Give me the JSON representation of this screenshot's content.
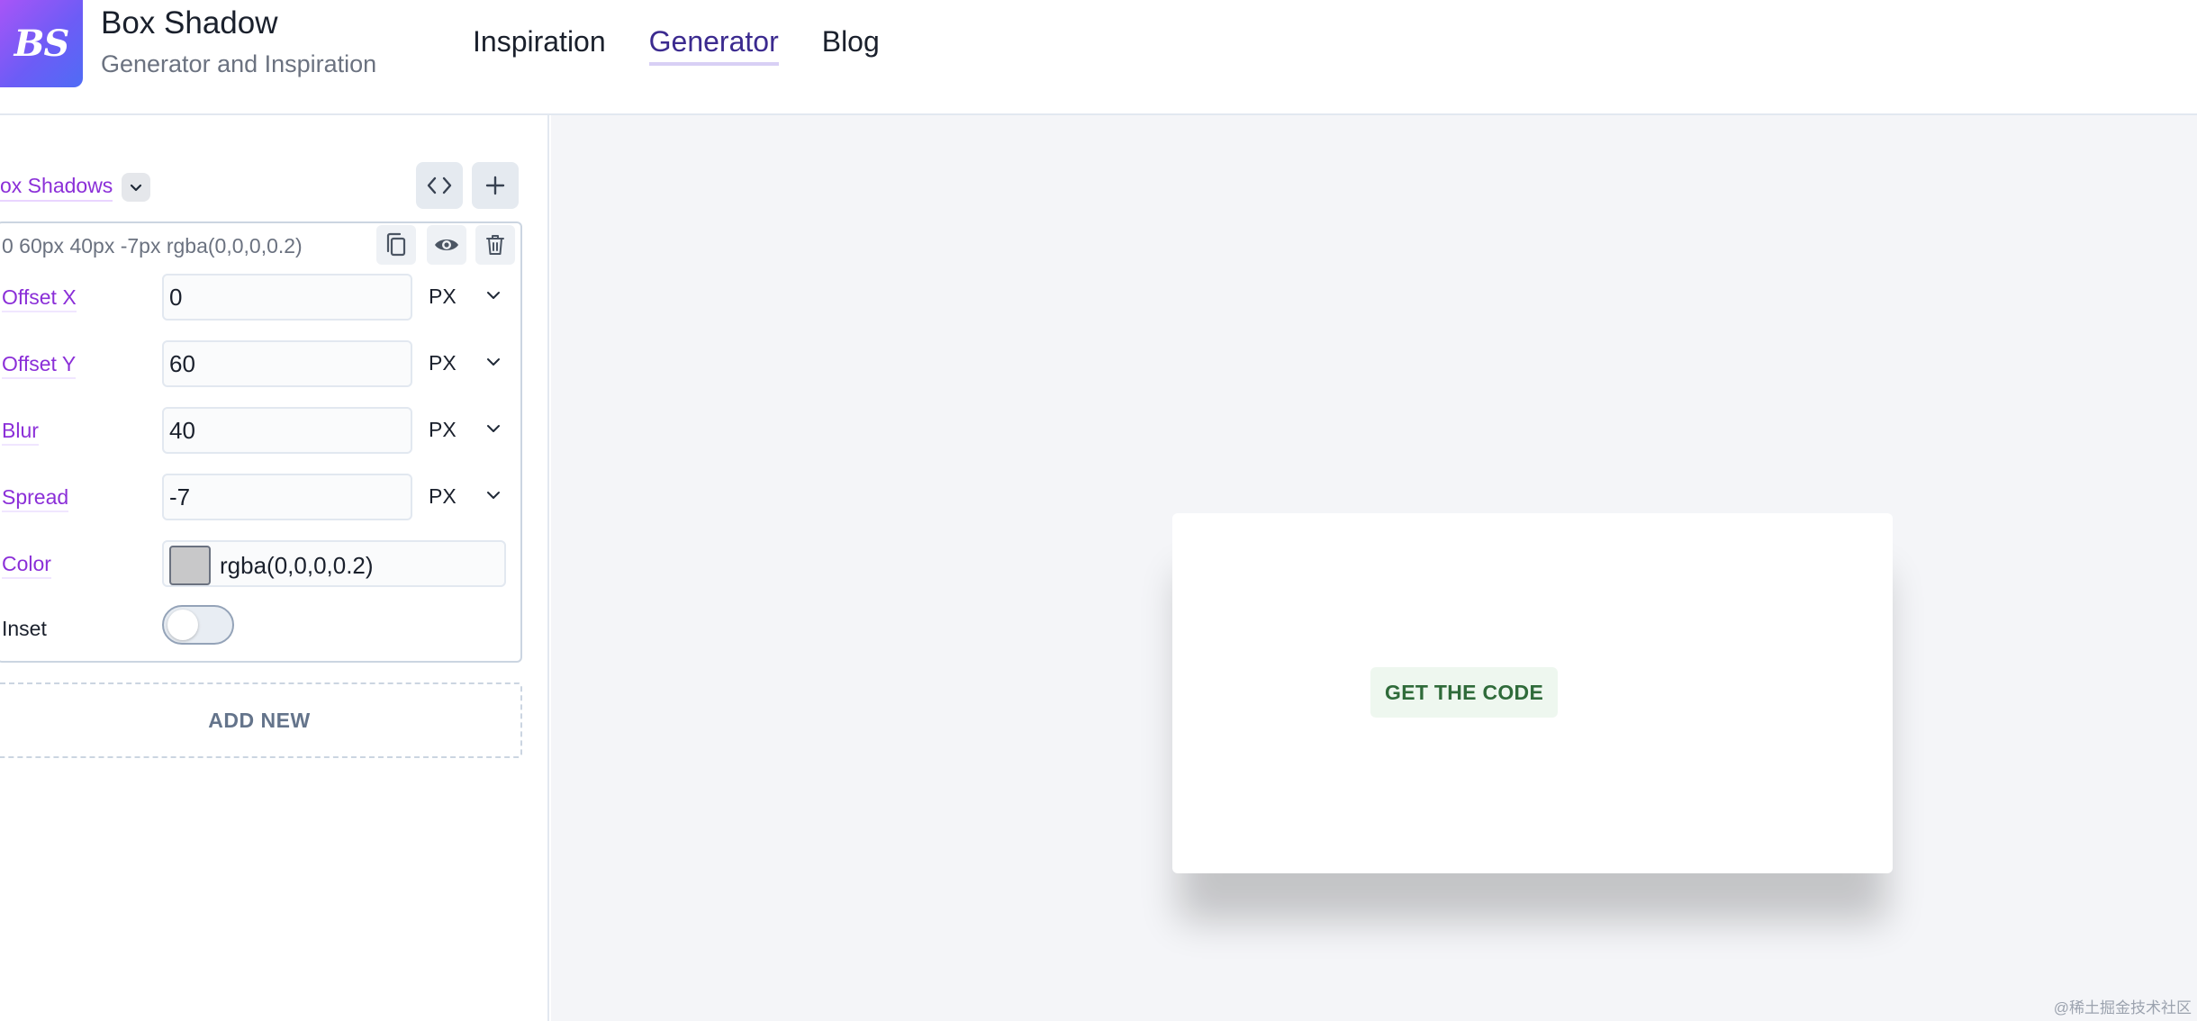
{
  "header": {
    "logo_text": "BS",
    "title": "Box Shadow",
    "subtitle": "Generator and Inspiration",
    "nav": [
      {
        "label": "Inspiration"
      },
      {
        "label": "Generator"
      },
      {
        "label": "Blog"
      }
    ]
  },
  "sidebar": {
    "list_title": "ox Shadows",
    "shadow_summary": "0 60px 40px -7px rgba(0,0,0,0.2)",
    "fields": {
      "offset_x": {
        "label": "Offset X",
        "value": "0",
        "unit": "PX"
      },
      "offset_y": {
        "label": "Offset Y",
        "value": "60",
        "unit": "PX"
      },
      "blur": {
        "label": "Blur",
        "value": "40",
        "unit": "PX"
      },
      "spread": {
        "label": "Spread",
        "value": "-7",
        "unit": "PX"
      },
      "color": {
        "label": "Color",
        "value": "rgba(0,0,0,0.2)"
      },
      "inset": {
        "label": "Inset",
        "enabled": false
      }
    },
    "add_new_label": "ADD NEW"
  },
  "preview": {
    "cta_label": "GET THE CODE"
  },
  "watermark": "@稀土掘金技术社区",
  "colors": {
    "accent_purple": "#8b2fd8",
    "nav_active": "#3b2a8f",
    "cta_text": "#2f6b3a",
    "preview_bg": "#f4f5f8"
  },
  "icons": [
    "code-icon",
    "plus-icon",
    "copy-icon",
    "eye-icon",
    "trash-icon",
    "chevron-down-icon"
  ]
}
